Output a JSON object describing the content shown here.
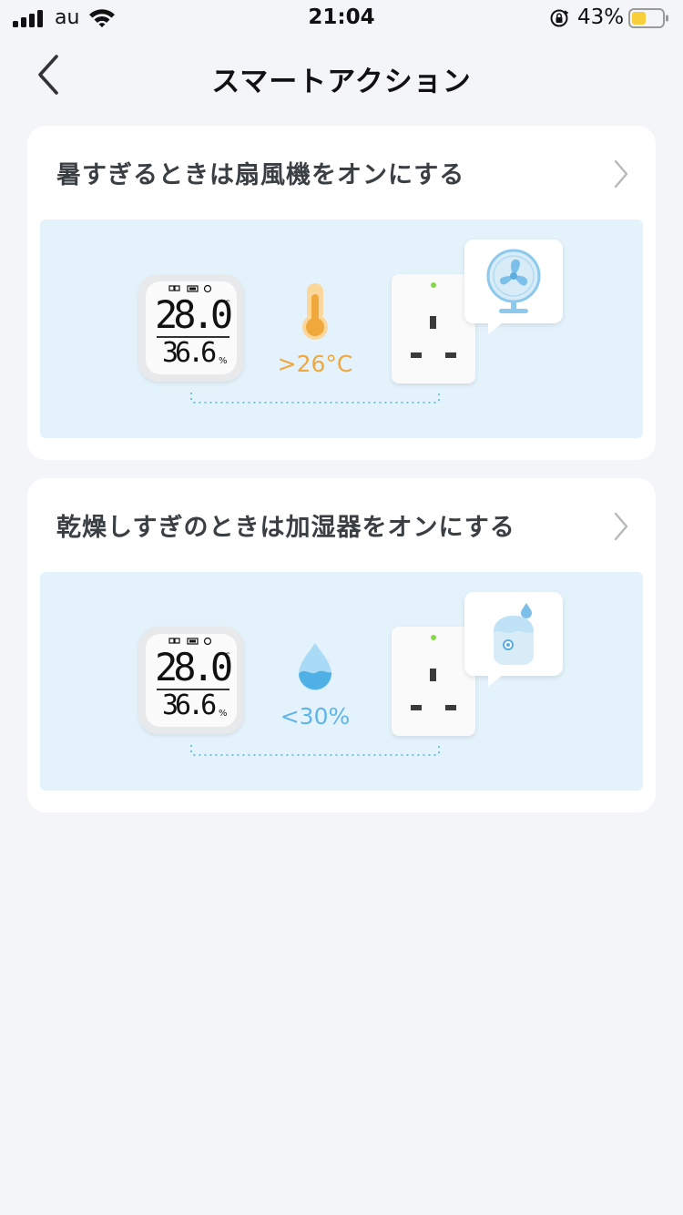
{
  "status_bar": {
    "carrier": "au",
    "time": "21:04",
    "battery_percent": "43%"
  },
  "nav": {
    "title": "スマートアクション"
  },
  "actions": [
    {
      "title": "暑すぎるときは扇風機をオンにする",
      "sensor": {
        "temperature": "28.0",
        "temperature_unit": "°C",
        "humidity": "36.6",
        "humidity_unit": "%"
      },
      "condition": ">26°C",
      "condition_icon": "thermometer-icon",
      "device_icon": "fan-icon"
    },
    {
      "title": "乾燥しすぎのときは加湿器をオンにする",
      "sensor": {
        "temperature": "28.0",
        "temperature_unit": "°C",
        "humidity": "36.6",
        "humidity_unit": "%"
      },
      "condition": "<30%",
      "condition_icon": "water-drop-icon",
      "device_icon": "humidifier-icon"
    }
  ],
  "colors": {
    "background": "#f3f5f9",
    "card": "#ffffff",
    "illustration_bg": "#e4f2fb",
    "temperature_accent": "#f0a83c",
    "humidity_accent": "#5fb5e8",
    "plug_led": "#86d84a"
  }
}
